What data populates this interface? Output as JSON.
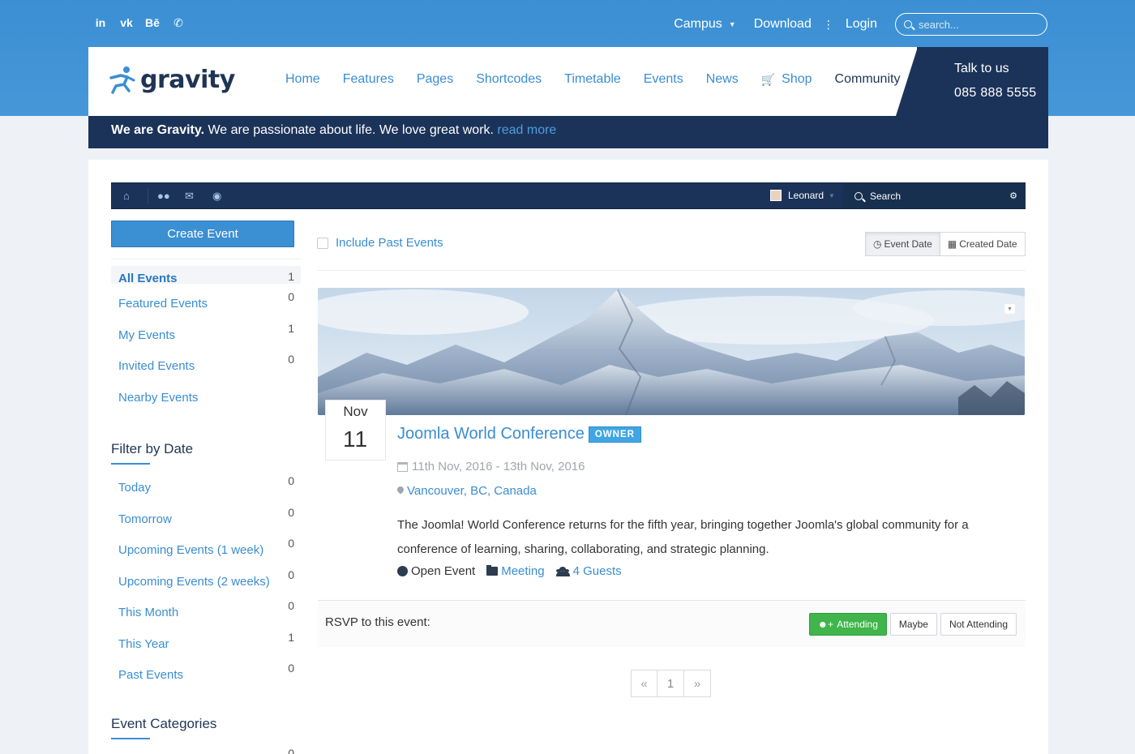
{
  "topbar": {
    "social": [
      {
        "icon": "linkedin-icon",
        "glyph": "in"
      },
      {
        "icon": "vk-icon",
        "glyph": "vk"
      },
      {
        "icon": "behance-icon",
        "glyph": "Bē"
      },
      {
        "icon": "whatsapp-icon",
        "glyph": "✆"
      }
    ],
    "campus": "Campus",
    "download": "Download",
    "login": "Login",
    "search_placeholder": "search..."
  },
  "header": {
    "logo_text": "gravity",
    "nav": [
      "Home",
      "Features",
      "Pages",
      "Shortcodes",
      "Timetable",
      "Events",
      "News",
      "Shop",
      "Community"
    ],
    "talk_label": "Talk to us",
    "phone": "085 888 5555"
  },
  "tagline": {
    "bold": "We are Gravity.",
    "text": " We are passionate about life. We love great work. ",
    "link": "read more"
  },
  "toolbar": {
    "user_name": "Leonard",
    "search_label": "Search"
  },
  "sidebar": {
    "create_button": "Create Event",
    "events": [
      {
        "label": "All Events",
        "count": "1"
      },
      {
        "label": "Featured Events",
        "count": "0"
      },
      {
        "label": "My Events",
        "count": "1"
      },
      {
        "label": "Invited Events",
        "count": "0"
      },
      {
        "label": "Nearby Events",
        "count": ""
      }
    ],
    "filter_title": "Filter by Date",
    "filters": [
      {
        "label": "Today",
        "count": "0"
      },
      {
        "label": "Tomorrow",
        "count": "0"
      },
      {
        "label": "Upcoming Events (1 week)",
        "count": "0"
      },
      {
        "label": "Upcoming Events (2 weeks)",
        "count": "0"
      },
      {
        "label": "This Month",
        "count": "0"
      },
      {
        "label": "This Year",
        "count": "1"
      },
      {
        "label": "Past Events",
        "count": "0"
      }
    ],
    "categories_title": "Event Categories",
    "category_count": "0"
  },
  "content": {
    "include_past": "Include Past Events",
    "sort_event_date": "Event Date",
    "sort_created_date": "Created Date",
    "event": {
      "month": "Nov",
      "day": "11",
      "title": "Joomla World Conference",
      "badge": "OWNER",
      "dates": "11th Nov, 2016 - 13th Nov, 2016",
      "location": "Vancouver, BC, Canada",
      "description": "The Joomla! World Conference returns for the fifth year, bringing together Joomla's global community for a conference of learning, sharing, collaborating, and strategic planning.",
      "type": "Open Event",
      "category": "Meeting",
      "guests": "4 Guests"
    },
    "rsvp_label": "RSVP to this event:",
    "rsvp_attending": "Attending",
    "rsvp_maybe": "Maybe",
    "rsvp_not": "Not Attending",
    "pager_prev": "«",
    "pager_current": "1",
    "pager_next": "»"
  },
  "colors": {
    "brand_blue": "#3b8fd3",
    "navy": "#1c3359",
    "green": "#3fb54b"
  }
}
